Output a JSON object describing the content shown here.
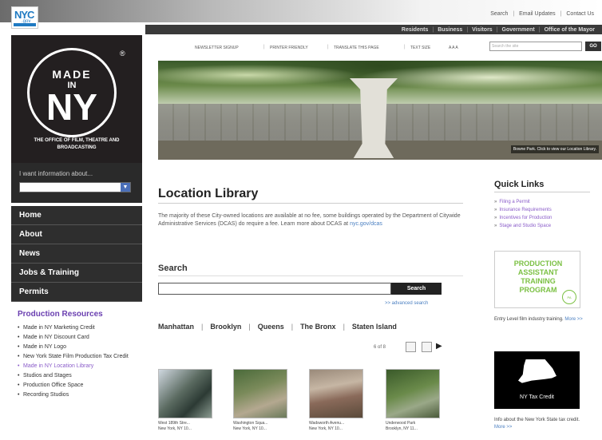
{
  "header": {
    "nyc_logo_text": "NYC",
    "nyc_logo_gov": ".gov",
    "util_links": [
      "Search",
      "Email Updates",
      "Contact Us"
    ],
    "main_nav": [
      "Residents",
      "Business",
      "Visitors",
      "Government",
      "Office of the Mayor"
    ]
  },
  "toolbar": {
    "items": [
      "Newsletter Signup",
      "Printer Friendly",
      "Translate This Page",
      "Text Size"
    ],
    "size_glyphs": "A A A",
    "search_placeholder": "Search the site",
    "go_label": "GO"
  },
  "sidebar": {
    "logo": {
      "made": "MADE",
      "in": "IN",
      "ny": "NY",
      "reg": "®"
    },
    "office": "The Office of Film, Theatre and Broadcasting",
    "want_label": "I want information about...",
    "want_arrow": "▼",
    "nav": [
      "Home",
      "About",
      "News",
      "Jobs & Training",
      "Permits"
    ],
    "resources_heading": "Production Resources",
    "resources": [
      "Made in NY Marketing Credit",
      "Made in NY Discount Card",
      "Made in NY Logo",
      "New York State Film Production Tax Credit",
      "Made in NY Location Library",
      "Studios and Stages",
      "Production Office Space",
      "Recording Studios"
    ]
  },
  "hero": {
    "caption": "Bowne Park. Click to view our Location Library."
  },
  "main": {
    "title": "Location Library",
    "intro": "The majority of these City-owned locations are available at no fee, some buildings operated by the Department of Citywide Administrative Services (DCAS) do require a fee. Learn more about DCAS at",
    "intro_link": "nyc.gov/dcas",
    "search_heading": "Search",
    "search_button": "Search",
    "advanced": ">> advanced search",
    "boroughs": [
      "Manhattan",
      "Brooklyn",
      "Queens",
      "The Bronx",
      "Staten Island"
    ],
    "pager_text": "6 of 8",
    "pager_next": "▶",
    "thumbs": [
      {
        "title": "West 189th Stre...",
        "sub": "New York, NY 10..."
      },
      {
        "title": "Washington Squa...",
        "sub": "New York, NY 10..."
      },
      {
        "title": "Wadsworth Avenu...",
        "sub": "New York, NY 10..."
      },
      {
        "title": "Underwood Park",
        "sub": "Brooklyn, NY 11..."
      }
    ]
  },
  "quick_links": {
    "title": "Quick Links",
    "items": [
      "Filing a Permit",
      "Insurance Requirements",
      "Incentives for Production",
      "Stage and Studio Space"
    ],
    "prod_box_text": "Production Assistant Training Program",
    "prod_badge": "PA",
    "prod_caption": "Entry Level film industry training.",
    "more": "More >>",
    "tax_label": "NY Tax Credit",
    "tax_caption": "Info about the New York State tax credit."
  },
  "colors": {
    "purple_accent": "#8a5cc9",
    "link_blue": "#4a7fc1",
    "green_accent": "#7bc043",
    "sidebar_dark": "#231f20"
  }
}
